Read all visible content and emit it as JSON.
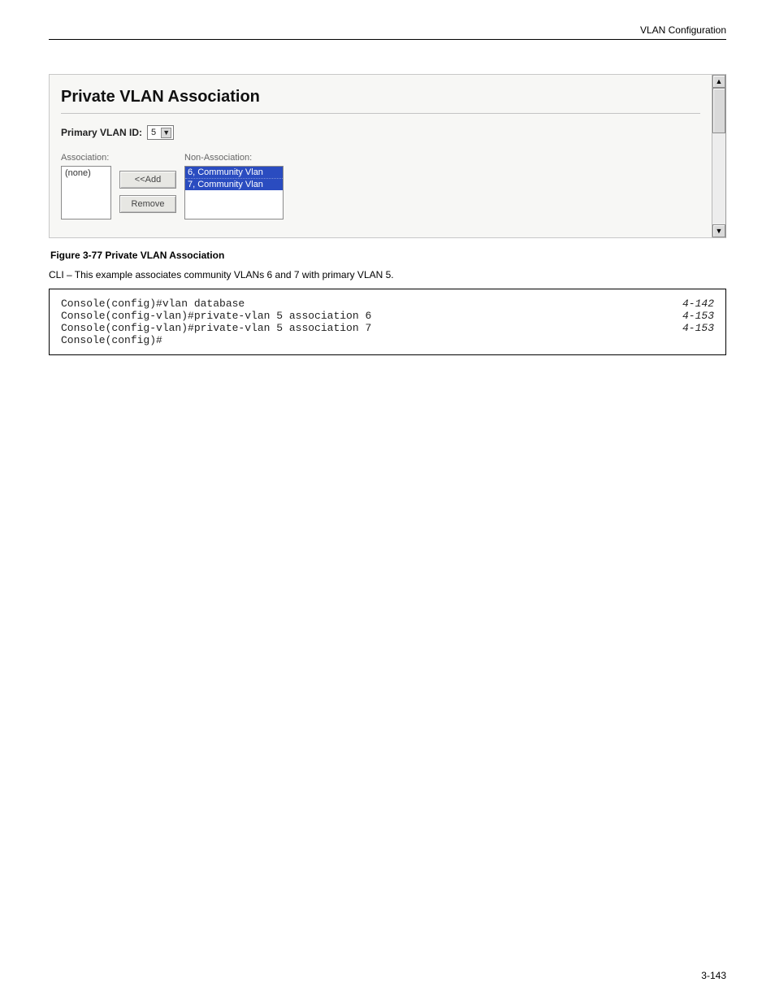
{
  "header": {
    "left": "",
    "right": "VLAN Configuration"
  },
  "figure": {
    "panel_title": "Private VLAN Association",
    "primary_label": "Primary VLAN ID:",
    "primary_value": "5",
    "assoc_label": "Association:",
    "assoc_items": [
      "(none)"
    ],
    "nonassoc_label": "Non-Association:",
    "nonassoc_items": [
      "6, Community Vlan",
      "7, Community Vlan"
    ],
    "btn_add": "<<Add",
    "btn_remove": "Remove",
    "caption": "Figure 3-77   Private VLAN Association"
  },
  "cli_caption": "CLI – This example associates community VLANs 6 and 7 with primary VLAN 5.",
  "code": {
    "lines": [
      {
        "cmd": "Console(config)#vlan database",
        "ref": "4-142"
      },
      {
        "cmd": "Console(config-vlan)#private-vlan 5 association 6",
        "ref": "4-153"
      },
      {
        "cmd": "Console(config-vlan)#private-vlan 5 association 7",
        "ref": "4-153"
      },
      {
        "cmd": "Console(config)#",
        "ref": ""
      }
    ]
  },
  "footer": {
    "left": "",
    "right": "3-143"
  }
}
